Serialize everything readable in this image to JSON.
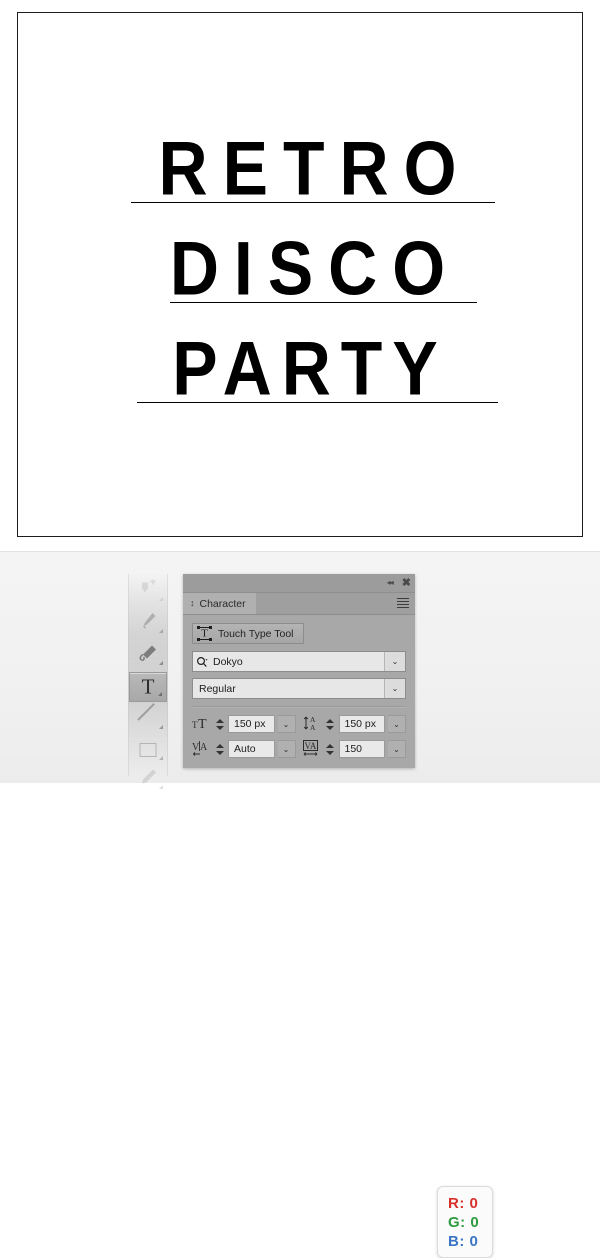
{
  "artboard": {
    "poster": {
      "line1": "RETRO",
      "line2": "DISCO",
      "line3": "PARTY"
    }
  },
  "toolbar": {
    "tools": [
      {
        "name": "add-anchor-point-tool",
        "label": "Add Anchor Point Tool",
        "glyph": "pen-add"
      },
      {
        "name": "pen-tool",
        "label": "Pen Tool",
        "glyph": "pen"
      },
      {
        "name": "pencil-tool",
        "label": "Pencil Tool",
        "glyph": "pencil"
      },
      {
        "name": "type-tool",
        "label": "Type Tool",
        "glyph": "T",
        "selected": true
      },
      {
        "name": "line-segment-tool",
        "label": "Line Segment Tool",
        "glyph": "line"
      },
      {
        "name": "rectangle-tool",
        "label": "Rectangle Tool",
        "glyph": "rect"
      },
      {
        "name": "paintbrush-tool",
        "label": "Paintbrush Tool",
        "glyph": "brush"
      }
    ]
  },
  "character_panel": {
    "titlebar": {
      "collapse_icon": "◂◂",
      "close_icon": "✖"
    },
    "tab": {
      "label": "Character",
      "drag_icon": "↕",
      "menu_icon": "hamburger-menu-icon"
    },
    "touch_type_tool": {
      "label": "Touch Type Tool"
    },
    "font_family": {
      "value": "Dokyo",
      "arrow": "⌄"
    },
    "font_style": {
      "value": "Regular",
      "arrow": "⌄"
    },
    "metrics": [
      {
        "name": "font-size",
        "icon": "font-size-icon",
        "value": "150 px",
        "arrow": "⌄"
      },
      {
        "name": "leading",
        "icon": "leading-icon",
        "value": "150 px",
        "arrow": "⌄"
      },
      {
        "name": "kerning",
        "icon": "kerning-icon",
        "value": "Auto",
        "arrow": "⌄"
      },
      {
        "name": "tracking",
        "icon": "tracking-icon",
        "value": "150",
        "arrow": "⌄"
      }
    ]
  },
  "rgb_card": {
    "r": "R: 0",
    "g": "G: 0",
    "b": "B: 0",
    "colors": {
      "r": "#d8302a",
      "g": "#2e9b3e",
      "b": "#3a76c4"
    }
  }
}
